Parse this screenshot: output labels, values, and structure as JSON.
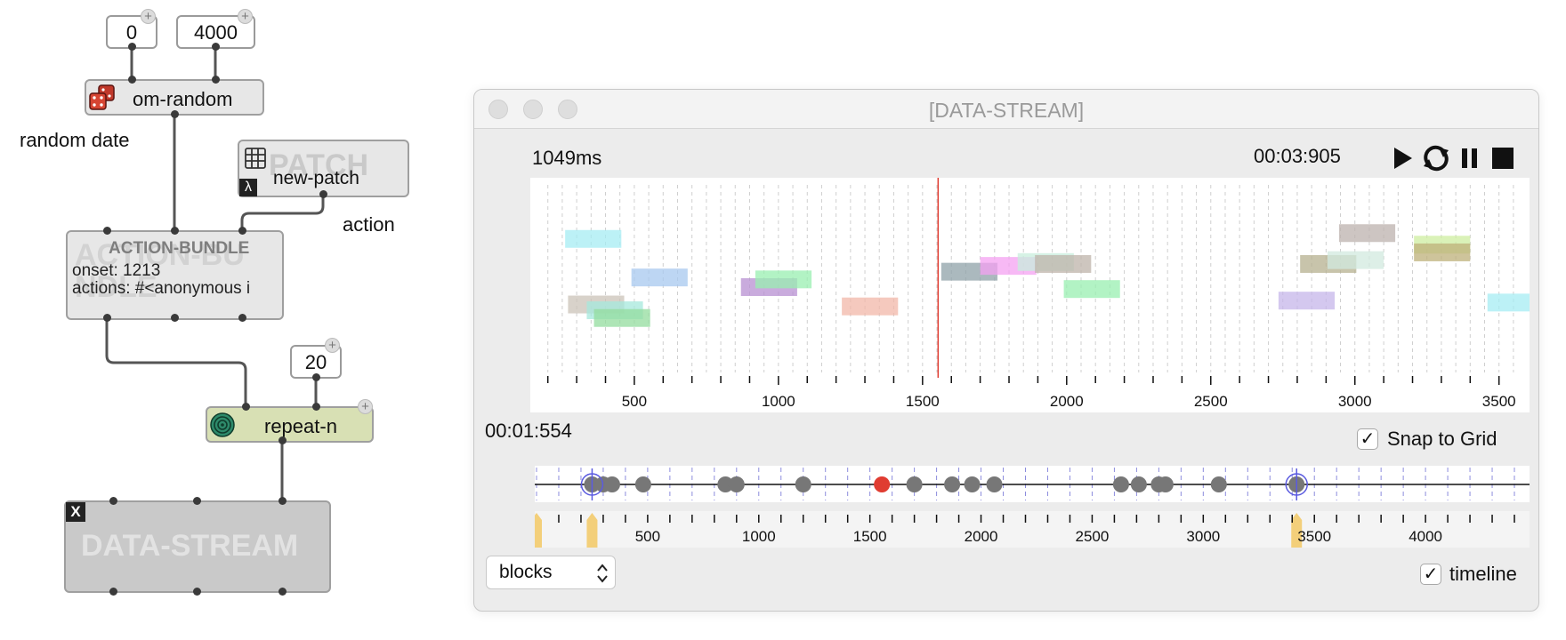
{
  "patch": {
    "inputs": [
      {
        "value": "0",
        "add_label": "+"
      },
      {
        "value": "4000",
        "add_label": "+"
      },
      {
        "value": "20",
        "add_label": "+"
      }
    ],
    "om_random": {
      "label": "om-random",
      "icon": "dice-icon",
      "icon_color": "#c0392b"
    },
    "comment_random_date": "random date",
    "comment_action": "action",
    "patch_box": {
      "title": "PATCH",
      "label": "new-patch",
      "lambda": "λ",
      "icon": "grid-icon"
    },
    "action_bundle": {
      "title": "ACTION-BUNDLE",
      "ghost_name": "ACTION-BU NDLE",
      "onset": "onset: 1213",
      "actions": "actions: #<anonymous i"
    },
    "repeat_n": {
      "label": "repeat-n",
      "icon": "spiral-icon",
      "color": "#d8e0b4"
    },
    "data_stream_box": {
      "label": "DATA-STREAM",
      "close": "X"
    }
  },
  "window": {
    "title": "[DATA-STREAM]",
    "duration_text": "1049ms",
    "time_display": "00:03:905",
    "cursor_time": "00:01:554",
    "snap_label": "Snap to Grid",
    "snap_checked": "✓",
    "timeline_label": "timeline",
    "timeline_checked": "✓",
    "mode_select": "blocks",
    "colors": {
      "playhead": "#e03c31",
      "selected_point": "#e03c31",
      "marker": "#f3cf7a",
      "point": "#777777"
    },
    "top_axis": {
      "min": 170,
      "max": 3575,
      "labels": [
        500,
        1000,
        1500,
        2000,
        2500,
        3000,
        3500
      ],
      "playhead": 1554
    },
    "bottom_axis": {
      "min": 0,
      "max": 4460,
      "labels": [
        500,
        1000,
        1500,
        2000,
        2500,
        3000,
        3500,
        4000
      ]
    }
  },
  "chart_data": [
    {
      "type": "blocks",
      "xlim": [
        170,
        3575
      ],
      "blocks": [
        {
          "onset": 260,
          "duration": 195,
          "level": 0.72,
          "color": "#a6ecf3"
        },
        {
          "onset": 270,
          "duration": 195,
          "level": 0.38,
          "color": "#cbc3b8"
        },
        {
          "onset": 335,
          "duration": 195,
          "level": 0.35,
          "color": "#a6e8dc"
        },
        {
          "onset": 360,
          "duration": 195,
          "level": 0.31,
          "color": "#93dc9e"
        },
        {
          "onset": 490,
          "duration": 195,
          "level": 0.52,
          "color": "#a7c8ef"
        },
        {
          "onset": 870,
          "duration": 195,
          "level": 0.47,
          "color": "#b78fd1"
        },
        {
          "onset": 920,
          "duration": 195,
          "level": 0.51,
          "color": "#98efb0"
        },
        {
          "onset": 1220,
          "duration": 195,
          "level": 0.37,
          "color": "#f2b7a8"
        },
        {
          "onset": 1565,
          "duration": 195,
          "level": 0.55,
          "color": "#8fa1a8"
        },
        {
          "onset": 1700,
          "duration": 195,
          "level": 0.58,
          "color": "#f4a2f2"
        },
        {
          "onset": 1830,
          "duration": 195,
          "level": 0.6,
          "color": "#c8eedc"
        },
        {
          "onset": 1890,
          "duration": 195,
          "level": 0.59,
          "color": "#bdb3a9"
        },
        {
          "onset": 1990,
          "duration": 195,
          "level": 0.46,
          "color": "#98efb0"
        },
        {
          "onset": 2735,
          "duration": 195,
          "level": 0.4,
          "color": "#c6b5ea"
        },
        {
          "onset": 2810,
          "duration": 195,
          "level": 0.59,
          "color": "#b5b08f"
        },
        {
          "onset": 2905,
          "duration": 195,
          "level": 0.61,
          "color": "#d2eadf"
        },
        {
          "onset": 2945,
          "duration": 195,
          "level": 0.75,
          "color": "#bcb1ae"
        },
        {
          "onset": 3205,
          "duration": 195,
          "level": 0.69,
          "color": "#cdeea0"
        },
        {
          "onset": 3205,
          "duration": 195,
          "level": 0.65,
          "color": "#bdb07a"
        },
        {
          "onset": 3460,
          "duration": 195,
          "level": 0.39,
          "color": "#a6ecf3"
        }
      ],
      "tick_labels": [
        500,
        1000,
        1500,
        2000,
        2500,
        3000,
        3500
      ]
    },
    {
      "type": "scatter",
      "xlim": [
        0,
        4460
      ],
      "points": [
        250,
        300,
        340,
        480,
        850,
        900,
        1200,
        1554,
        1700,
        1870,
        1960,
        2060,
        2630,
        2710,
        2800,
        2830,
        3070,
        3420
      ],
      "selected": [
        1554
      ],
      "circled": [
        250,
        3420
      ],
      "markers": [
        0,
        250,
        3420
      ],
      "tick_labels": [
        500,
        1000,
        1500,
        2000,
        2500,
        3000,
        3500,
        4000
      ]
    }
  ]
}
